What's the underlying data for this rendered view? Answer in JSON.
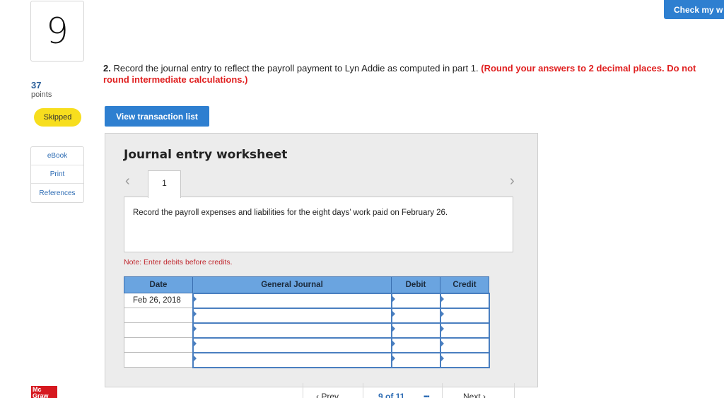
{
  "question": {
    "number": "9",
    "points_value": "37",
    "points_label": "points",
    "status": "Skipped",
    "number_prefix": "2.",
    "text": " Record the journal entry to reflect the payroll payment to Lyn Addie as computed in part 1. ",
    "instruction": "(Round your answers to 2 decimal places. Do not round intermediate calculations.)"
  },
  "header": {
    "check_label": "Check my w"
  },
  "resources": [
    "eBook",
    "Print",
    "References"
  ],
  "actions": {
    "view_transaction_list": "View transaction list"
  },
  "worksheet": {
    "title": "Journal entry worksheet",
    "prev_arrow": "‹",
    "next_arrow": "›",
    "active_tab": "1",
    "description": "Record the payroll expenses and liabilities for the eight days’ work paid on February 26.",
    "note": "Note: Enter debits before credits.",
    "columns": [
      "Date",
      "General Journal",
      "Debit",
      "Credit"
    ],
    "rows": [
      {
        "date": "Feb 26, 2018",
        "journal": "",
        "debit": "",
        "credit": ""
      },
      {
        "date": "",
        "journal": "",
        "debit": "",
        "credit": ""
      },
      {
        "date": "",
        "journal": "",
        "debit": "",
        "credit": ""
      },
      {
        "date": "",
        "journal": "",
        "debit": "",
        "credit": ""
      },
      {
        "date": "",
        "journal": "",
        "debit": "",
        "credit": ""
      }
    ]
  },
  "footer": {
    "logo_text": "Mc Graw",
    "prev_label": "‹ Prev",
    "page_text": "9 of 11",
    "grid_icon": "grid-icon",
    "next_label": "Next ›"
  },
  "colors": {
    "accent_blue": "#2e7fd0",
    "header_blue": "#6aa4e0",
    "warning_red": "#e02020",
    "skipped_yellow": "#f7de1e",
    "logo_red": "#d6181f"
  }
}
